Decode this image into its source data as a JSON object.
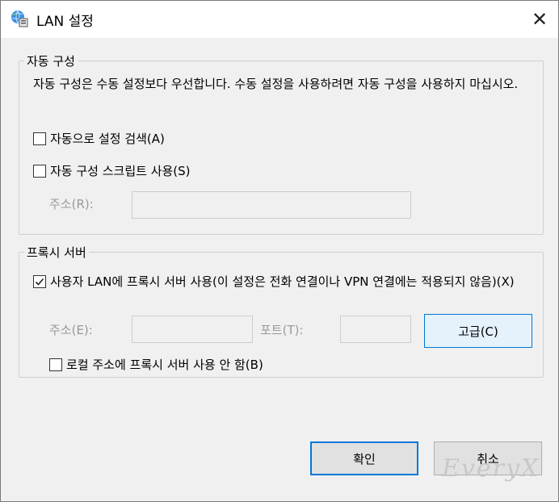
{
  "window": {
    "title": "LAN 설정",
    "close_glyph": "✕",
    "icon": "network-globe-icon"
  },
  "auto_config": {
    "group_title": "자동 구성",
    "description": "자동 구성은 수동 설정보다 우선합니다. 수동 설정을 사용하려면 자동 구성을 사용하지 마십시오.",
    "auto_detect_label": "자동으로 설정 검색(A)",
    "auto_detect_checked": false,
    "script_label": "자동 구성 스크립트 사용(S)",
    "script_checked": false,
    "address_label": "주소(R):",
    "address_value": ""
  },
  "proxy": {
    "group_title": "프록시 서버",
    "use_proxy_label": "사용자 LAN에 프록시 서버 사용(이 설정은 전화 연결이나 VPN 연결에는 적용되지 않음)(X)",
    "use_proxy_checked": true,
    "address_label": "주소(E):",
    "address_value": "",
    "port_label": "포트(T):",
    "port_value": "",
    "advanced_button": "고급(C)",
    "bypass_local_label": "로컬 주소에 프록시 서버 사용 안 함(B)",
    "bypass_local_checked": false
  },
  "footer": {
    "ok_button": "확인",
    "cancel_button": "취소"
  },
  "watermark": "EveryX",
  "colors": {
    "accent": "#0078d7",
    "window_bg": "#f0f0f0",
    "titlebar_bg": "#ffffff"
  }
}
